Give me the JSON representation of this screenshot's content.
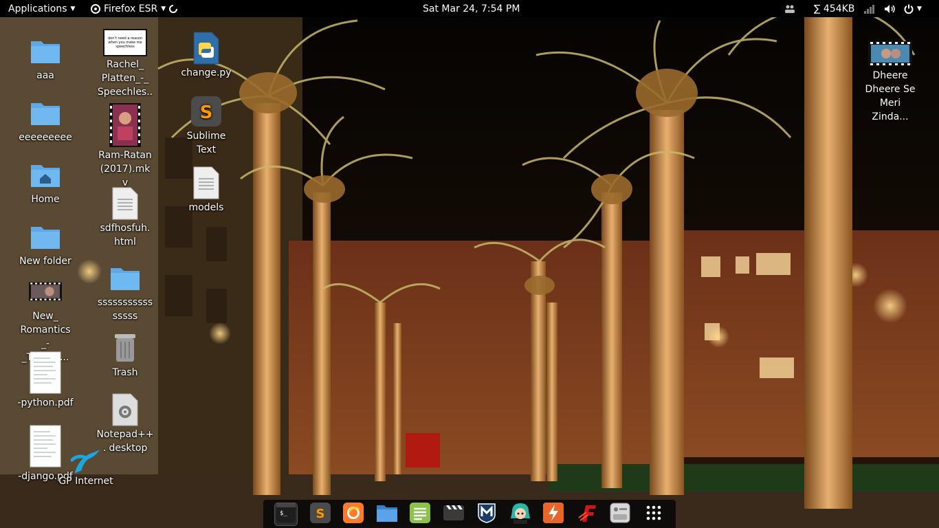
{
  "topbar": {
    "applications_label": "Applications",
    "active_app_label": "Firefox ESR",
    "datetime": "Sat Mar 24,  7:54 PM",
    "network_speed": "∑ 454KB"
  },
  "desktop": {
    "col1": [
      {
        "label": "aaa",
        "icon": "folder-icon"
      },
      {
        "label": "eeeeeeeee",
        "icon": "folder-icon"
      },
      {
        "label": "Home",
        "icon": "home-folder-icon"
      },
      {
        "label": "New folder",
        "icon": "folder-icon"
      },
      {
        "label": "New_ Romantics_-_Taylor_...",
        "icon": "video-thumbnail-icon"
      },
      {
        "label": "-python.pdf",
        "icon": "pdf-icon"
      },
      {
        "label": "-django.pdf",
        "icon": "pdf-icon"
      }
    ],
    "col2": [
      {
        "label": "Rachel_ Platten_-_ Speechles...",
        "icon": "video-thumbnail-icon",
        "thumb_text": "don't need a reason when you make me speechless"
      },
      {
        "label": "Ram-Ratan (2017).mkv",
        "icon": "video-thumbnail-icon"
      },
      {
        "label": "sdfhosfuh. html",
        "icon": "text-file-icon"
      },
      {
        "label": "ssssssssssssssss",
        "icon": "folder-icon"
      },
      {
        "label": "Trash",
        "icon": "trash-icon"
      },
      {
        "label": "Notepad++. desktop",
        "icon": "desktop-file-icon"
      }
    ],
    "col3": [
      {
        "label": "change.py",
        "icon": "python-file-icon"
      },
      {
        "label": "Sublime Text",
        "icon": "sublime-text-icon"
      },
      {
        "label": "models",
        "icon": "text-file-icon"
      }
    ],
    "right": [
      {
        "label": "Dheere Dheere Se Meri Zinda...",
        "icon": "video-thumbnail-icon"
      }
    ],
    "gp_internet": {
      "label": "GP Internet",
      "icon": "gp-internet-icon"
    }
  },
  "dock": {
    "apps": [
      {
        "name": "terminal-icon",
        "color": "#2b2b2b"
      },
      {
        "name": "sublime-text-icon",
        "color": "#4a4a4a"
      },
      {
        "name": "firefox-icon",
        "color": "#ff7b2c"
      },
      {
        "name": "files-icon",
        "color": "#4a90d9"
      },
      {
        "name": "text-editor-icon",
        "color": "#8bc34a"
      },
      {
        "name": "video-player-icon",
        "color": "#3a3a3a"
      },
      {
        "name": "metasploit-icon",
        "color": "#1a3a6a"
      },
      {
        "name": "anime-app-icon",
        "color": "#27b6a8"
      },
      {
        "name": "burpsuite-icon",
        "color": "#e8662a"
      },
      {
        "name": "faraday-icon",
        "color": "#d4141b"
      },
      {
        "name": "settings-panel-icon",
        "color": "#cfcfcf"
      },
      {
        "name": "show-apps-grid-icon",
        "color": "#ffffff"
      }
    ]
  }
}
